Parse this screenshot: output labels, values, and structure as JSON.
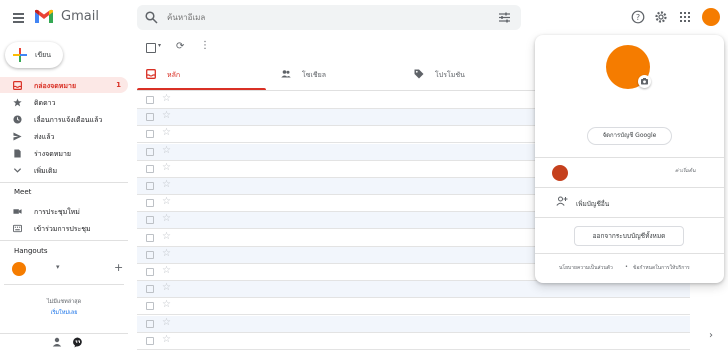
{
  "header": {
    "app_name": "Gmail",
    "search_placeholder": "ค้นหาอีเมล",
    "accent": "#ea4335"
  },
  "sidebar": {
    "compose_label": "เขียน",
    "items": [
      {
        "label": "กล่องจดหมาย",
        "count": "1",
        "icon": "inbox-icon",
        "active": true
      },
      {
        "label": "ติดดาว",
        "icon": "star-icon"
      },
      {
        "label": "เลื่อนการแจ้งเตือนแล้ว",
        "icon": "clock-icon"
      },
      {
        "label": "ส่งแล้ว",
        "icon": "send-icon"
      },
      {
        "label": "ร่างจดหมาย",
        "icon": "draft-icon"
      },
      {
        "label": "เพิ่มเติม",
        "icon": "chevron-down-icon"
      }
    ],
    "meet": {
      "title": "Meet",
      "items": [
        {
          "label": "การประชุมใหม่",
          "icon": "video-icon"
        },
        {
          "label": "เข้าร่วมการประชุม",
          "icon": "keyboard-icon"
        }
      ]
    },
    "hangouts": {
      "title": "Hangouts",
      "recent_none": "ไม่มีแชทล่าสุด",
      "start_new": "เริ่มใหม่เลย"
    }
  },
  "tabs": [
    {
      "label": "หลัก",
      "icon": "inbox-tab-icon"
    },
    {
      "label": "โซเชียล",
      "icon": "people-icon"
    },
    {
      "label": "โปรโมชัน",
      "icon": "tag-icon"
    }
  ],
  "email_row_count": 15,
  "account_panel": {
    "manage_button": "จัดการบัญชี Google",
    "signed_out": "ค่าเริ่มต้น",
    "add_account": "เพิ่มบัญชีอื่น",
    "sign_out_all": "ออกจากระบบบัญชีทั้งหมด",
    "privacy": "นโยบายความเป็นส่วนตัว",
    "separator": "•",
    "terms": "ข้อกำหนดในการให้บริการ",
    "avatar_color": "#f57c00",
    "second_avatar_color": "#c5401d"
  }
}
